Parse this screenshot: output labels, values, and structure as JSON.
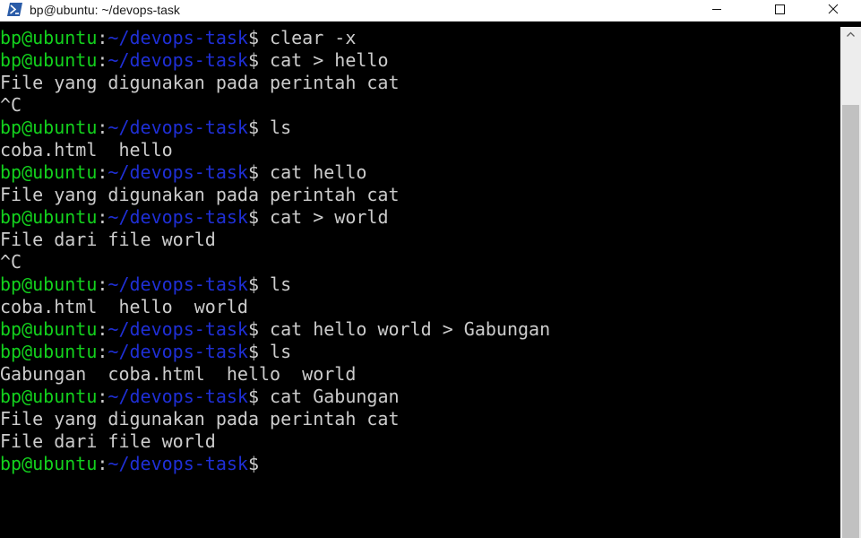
{
  "window": {
    "title": "bp@ubuntu: ~/devops-task",
    "icon": "powershell-icon"
  },
  "controls": {
    "minimize_icon": "minimize-icon",
    "maximize_icon": "maximize-icon",
    "close_icon": "close-icon"
  },
  "prompt": {
    "user_host": "bp@ubuntu",
    "separator": ":",
    "path": "~/devops-task",
    "symbol": "$"
  },
  "colors": {
    "background": "#000000",
    "user_host": "#13d11d",
    "path": "#1f2fd6",
    "text": "#cccccc"
  },
  "lines": [
    {
      "type": "prompt",
      "command": " clear -x"
    },
    {
      "type": "prompt",
      "command": " cat > hello"
    },
    {
      "type": "output",
      "text": "File yang digunakan pada perintah cat"
    },
    {
      "type": "output",
      "text": "^C"
    },
    {
      "type": "prompt",
      "command": " ls"
    },
    {
      "type": "output",
      "text": "coba.html  hello"
    },
    {
      "type": "prompt",
      "command": " cat hello"
    },
    {
      "type": "output",
      "text": "File yang digunakan pada perintah cat"
    },
    {
      "type": "prompt",
      "command": " cat > world"
    },
    {
      "type": "output",
      "text": "File dari file world"
    },
    {
      "type": "output",
      "text": "^C"
    },
    {
      "type": "prompt",
      "command": " ls"
    },
    {
      "type": "output",
      "text": "coba.html  hello  world"
    },
    {
      "type": "prompt",
      "command": " cat hello world > Gabungan"
    },
    {
      "type": "prompt",
      "command": " ls"
    },
    {
      "type": "output",
      "text": "Gabungan  coba.html  hello  world"
    },
    {
      "type": "prompt",
      "command": " cat Gabungan"
    },
    {
      "type": "output",
      "text": "File yang digunakan pada perintah cat"
    },
    {
      "type": "output",
      "text": "File dari file world"
    },
    {
      "type": "prompt",
      "command": ""
    }
  ]
}
